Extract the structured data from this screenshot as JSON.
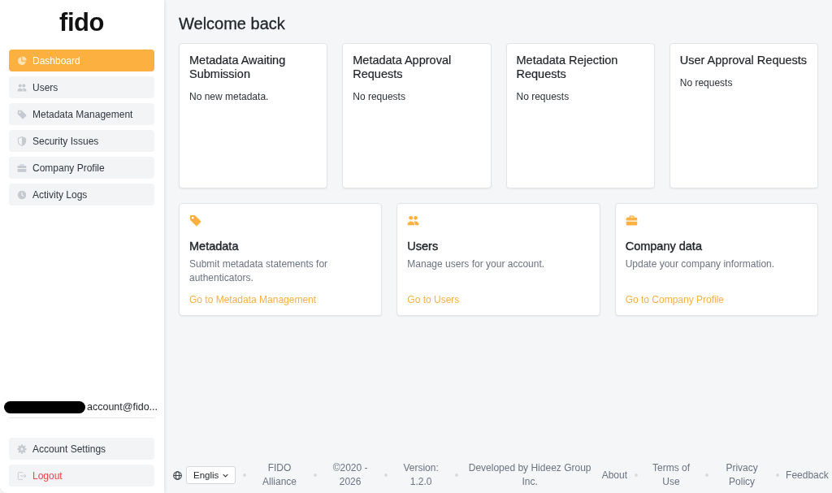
{
  "sidebar": {
    "logo": "fido",
    "items": [
      {
        "label": "Dashboard",
        "selected": true
      },
      {
        "label": "Users",
        "selected": false
      },
      {
        "label": "Metadata Management",
        "selected": false
      },
      {
        "label": "Security Issues",
        "selected": false
      },
      {
        "label": "Company Profile",
        "selected": false
      },
      {
        "label": "Activity Logs",
        "selected": false
      }
    ],
    "account": {
      "redacted": true,
      "email": "account@fido..."
    },
    "bottom_items": [
      {
        "label": "Account Settings",
        "kind": "settings"
      },
      {
        "label": "Logout",
        "kind": "logout"
      }
    ]
  },
  "main": {
    "title": "Welcome back",
    "summary_cards": [
      {
        "title": "Metadata Awaiting Submission",
        "text": "No new metadata."
      },
      {
        "title": "Metadata Approval Requests",
        "text": "No requests"
      },
      {
        "title": "Metadata Rejection Requests",
        "text": "No requests"
      },
      {
        "title": "User Approval Requests",
        "text": "No requests"
      }
    ],
    "feature_cards": [
      {
        "title": "Metadata",
        "description": "Submit metadata statements for authenticators.",
        "link": "Go to Metadata Management"
      },
      {
        "title": "Users",
        "description": "Manage users for your account.",
        "link": "Go to Users"
      },
      {
        "title": "Company data",
        "description": "Update your company information.",
        "link": "Go to Company Profile"
      }
    ]
  },
  "footer": {
    "language": "Englis",
    "info": [
      "FIDO Alliance",
      "©2020 - 2026",
      "Version: 1.2.0",
      "Developed by Hideez Group Inc."
    ],
    "links": [
      "About",
      "Terms of Use",
      "Privacy Policy",
      "Feedback"
    ]
  }
}
